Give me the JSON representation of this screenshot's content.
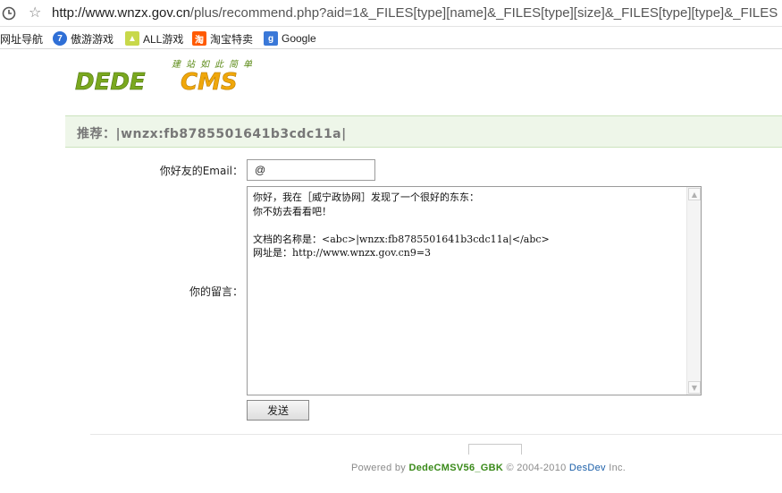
{
  "browser": {
    "url_host": "http://www.wnzx.gov.cn",
    "url_rest": "/plus/recommend.php?aid=1&_FILES[type][name]&_FILES[type][size]&_FILES[type][type]&_FILES",
    "bookmarks": [
      {
        "label": "网址导航",
        "icon": "none"
      },
      {
        "label": "傲游游戏",
        "icon": "maxthon-games-icon"
      },
      {
        "label": "ALL游戏",
        "icon": "all-games-icon"
      },
      {
        "label": "淘宝特卖",
        "icon": "taobao-icon"
      },
      {
        "label": "Google",
        "icon": "google-icon"
      }
    ]
  },
  "logo": {
    "slogan": "建站如此简单",
    "wordmark_left": "DEDE",
    "wordmark_right": "CMS"
  },
  "banner": {
    "title": "推荐：|wnzx:fb8785501641b3cdc11a|"
  },
  "form": {
    "email_label": "你好友的Email：",
    "email_value": "@",
    "message_label": "你的留言：",
    "message_text": "你好，我在［威宁政协网］发现了一个很好的东东：\n你不妨去看看吧！\n\n文档的名称是：<abc>|wnzx:fb8785501641b3cdc11a|</abc>\n网址是：http://www.wnzx.gov.cn9=3",
    "send_label": "发送"
  },
  "footer": {
    "prefix": "Powered by ",
    "product": "DedeCMSV56_GBK",
    "middle": " © 2004-2010 ",
    "developer": "DesDev",
    "suffix": " Inc."
  },
  "colors": {
    "banner_bg": "#eef6e9",
    "logo_green": "#7aa81f",
    "logo_orange": "#f0a70a",
    "footer_green": "#3a8a1a",
    "footer_blue": "#1a5ea8"
  }
}
